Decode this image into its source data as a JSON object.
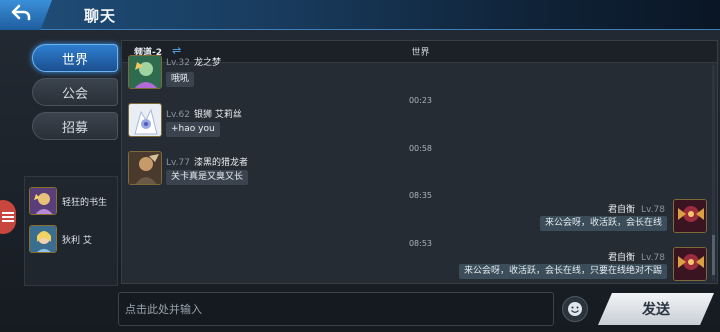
{
  "header": {
    "title": "聊天",
    "back_icon": "back-arrow-icon"
  },
  "tabs": [
    {
      "label": "世界",
      "active": true
    },
    {
      "label": "公会",
      "active": false
    },
    {
      "label": "招募",
      "active": false
    }
  ],
  "friends": [
    {
      "name": "轻狂的书生"
    },
    {
      "name": "狄利 艾"
    }
  ],
  "chat": {
    "channel_label": "频道-2",
    "channel_switch_icon": "swap-icon",
    "channel_name": "世界",
    "messages": [
      {
        "level": "Lv.32",
        "name": "龙之梦",
        "text": "哦吼",
        "self": false
      },
      {
        "time": "00:23"
      },
      {
        "level": "Lv.62",
        "name": "银狮 艾莉丝",
        "text": "+hao you",
        "self": false
      },
      {
        "time": "00:58"
      },
      {
        "level": "Lv.77",
        "name": "漆黑的猎龙者",
        "text": "关卡真是又臭又长",
        "self": false
      },
      {
        "time": "08:35"
      },
      {
        "level": "Lv.78",
        "name": "君自衡",
        "text": "来公会呀，收活跃，会长在线",
        "self": true
      },
      {
        "time": "08:53"
      },
      {
        "level": "Lv.78",
        "name": "君自衡",
        "text": "来公会呀，收活跃，会长在线，只要在线绝对不踢",
        "self": true
      }
    ]
  },
  "input": {
    "placeholder": "点击此处并输入",
    "value": ""
  },
  "emoji_icon": "emoji-face-icon",
  "send_label": "发送",
  "colors": {
    "accent": "#2f7fd0",
    "panel": "#262c33",
    "bubble": "#3b444e"
  }
}
